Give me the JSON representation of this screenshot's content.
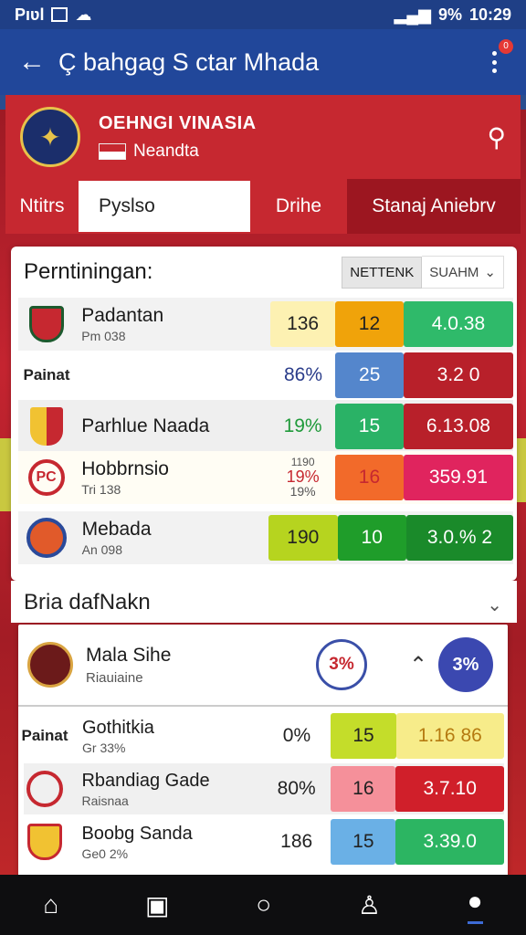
{
  "status_bar": {
    "left_text": "Pıʋl",
    "time": "10:29",
    "battery": "9%"
  },
  "appbar": {
    "title": "Ç bahgag S ctar Mhada"
  },
  "team": {
    "name": "OEHNGI VINASIA",
    "subtitle": "Neandta"
  },
  "tabs": [
    {
      "label": "Ntitrs"
    },
    {
      "label": "Pyslso"
    },
    {
      "label": "Drihe"
    },
    {
      "label": "Stanaj Aniebrv"
    }
  ],
  "section1": {
    "title": "Perntiningan:",
    "filter1": "NETTENK",
    "filter2": "SUAHM",
    "rows": [
      {
        "name": "Padantan",
        "sub": "Pm 038",
        "c1": "136",
        "c2": "12",
        "c3": "4.0.38"
      },
      {
        "name": "Painat",
        "sub": "",
        "c1": "86%",
        "c2": "25",
        "c3": "3.2 0"
      },
      {
        "name": "Parhlue Naada",
        "sub": "",
        "c1": "19%",
        "c2": "15",
        "c3": "6.13.08"
      },
      {
        "name": "Hobbrnsio",
        "sub": "Tri 138",
        "c1a": "1190",
        "c1": "19%",
        "c1b": "19%",
        "c2": "16",
        "c3": "359.91"
      },
      {
        "name": "Mebada",
        "sub": "An 098",
        "c1": "190",
        "c2": "10",
        "c3": "3.0.% 2"
      }
    ]
  },
  "section2": {
    "title": "Bria dafNakn",
    "featured": {
      "name": "Mala Sihe",
      "sub": "Riauiaine",
      "pct_left": "3%",
      "pct_right": "3%"
    },
    "rows": [
      {
        "name": "Gothitkia",
        "sub": "Gr 33%",
        "logo_text": "Painat",
        "c1": "0%",
        "c2": "15",
        "c3": "1.16 86"
      },
      {
        "name": "Rbandiag Gade",
        "sub": "Raisnaa",
        "c1": "80%",
        "c2": "16",
        "c3": "3.7.10"
      },
      {
        "name": "Boobg Sanda",
        "sub": "Ge0 2%",
        "c1": "186",
        "c2": "15",
        "c3": "3.39.0"
      }
    ]
  },
  "row_logo_texts": {
    "row1": "Painat",
    "row3": "PC"
  },
  "icons": {
    "back": "back-arrow-icon",
    "search": "search-icon",
    "menu": "more-vert-icon",
    "nav": [
      "home-icon",
      "clipboard-icon",
      "circle-icon",
      "profile-outline-icon",
      "profile-filled-icon"
    ]
  },
  "colors": {
    "primary": "#21479a",
    "accent": "#c62830"
  }
}
